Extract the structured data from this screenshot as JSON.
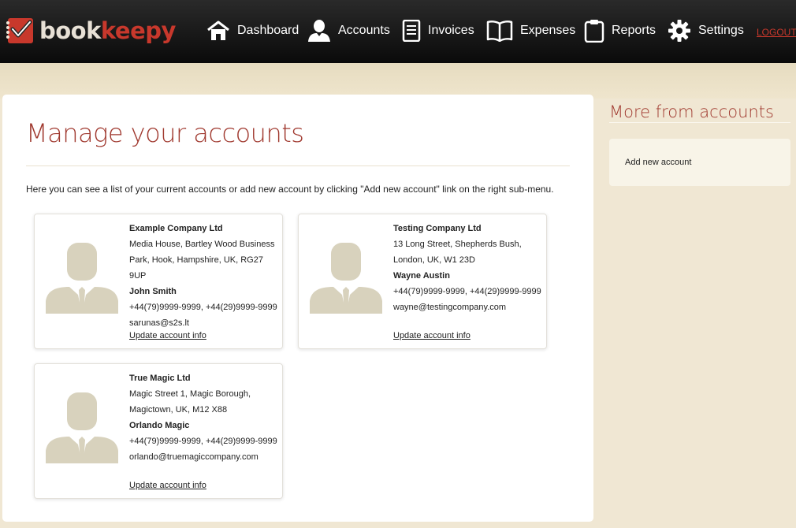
{
  "brand": {
    "part1": "book",
    "part2": "keepy"
  },
  "nav": [
    {
      "label": "Dashboard",
      "icon": "house-icon"
    },
    {
      "label": "Accounts",
      "icon": "person-icon"
    },
    {
      "label": "Invoices",
      "icon": "document-icon"
    },
    {
      "label": "Expenses",
      "icon": "open-book-icon"
    },
    {
      "label": "Reports",
      "icon": "clipboard-icon"
    },
    {
      "label": "Settings",
      "icon": "gear-icon"
    }
  ],
  "logout": "LOGOUT",
  "colors": {
    "accent": "#a0392f",
    "brand_red": "#c8382c",
    "page_bg": "#f0e7d3",
    "avatar": "#d8d2bd"
  },
  "main": {
    "title": "Manage your accounts",
    "intro": "Here you can see a list of your current accounts or add new account by clicking \"Add new account\" link on the right sub-menu."
  },
  "accounts": [
    {
      "company": "Example Company Ltd",
      "address1": "Media House, Bartley Wood Business",
      "address2": "Park, Hook, Hampshire, UK, RG27 9UP",
      "contact": "John Smith",
      "phones": "+44(79)9999-9999, +44(29)9999-9999",
      "email": "sarunas@s2s.lt",
      "link": "Update account info"
    },
    {
      "company": "Testing Company Ltd",
      "address1": "13 Long Street, Shepherds Bush,",
      "address2": "London, UK, W1 23D",
      "contact": "Wayne Austin",
      "phones": "+44(79)9999-9999, +44(29)9999-9999",
      "email": "wayne@testingcompany.com",
      "link": "Update account info"
    },
    {
      "company": "True Magic Ltd",
      "address1": "Magic Street 1, Magic Borough,",
      "address2": "Magictown, UK, M12 X88",
      "contact": "Orlando Magic",
      "phones": "+44(79)9999-9999, +44(29)9999-9999",
      "email": "orlando@truemagiccompany.com",
      "link": "Update account info"
    }
  ],
  "sidebar": {
    "title": "More from accounts",
    "items": [
      {
        "label": "Add new account"
      }
    ]
  }
}
